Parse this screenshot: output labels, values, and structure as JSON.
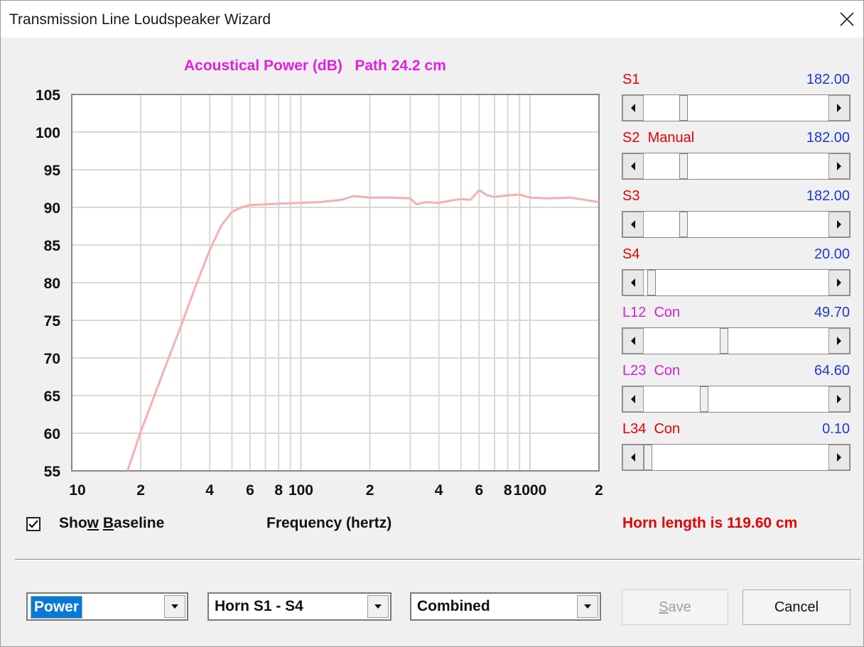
{
  "window": {
    "title": "Transmission Line Loudspeaker Wizard",
    "close_icon": "close-icon"
  },
  "chart_data": {
    "type": "line",
    "title": "Acoustical Power (dB)   Path 24.2 cm",
    "xlabel": "Frequency (hertz)",
    "x_scale": "log",
    "xlim": [
      10,
      2000
    ],
    "ylim": [
      55,
      105
    ],
    "y_ticks": [
      "105",
      "100",
      "95",
      "90",
      "85",
      "80",
      "75",
      "70",
      "65",
      "60",
      "55"
    ],
    "x_tick_labels": [
      {
        "freq": 10,
        "label": "10"
      },
      {
        "freq": 20,
        "label": "2"
      },
      {
        "freq": 40,
        "label": "4"
      },
      {
        "freq": 60,
        "label": "6"
      },
      {
        "freq": 80,
        "label": "8"
      },
      {
        "freq": 100,
        "label": "100"
      },
      {
        "freq": 200,
        "label": "2"
      },
      {
        "freq": 400,
        "label": "4"
      },
      {
        "freq": 600,
        "label": "6"
      },
      {
        "freq": 800,
        "label": "8"
      },
      {
        "freq": 1000,
        "label": "1000"
      },
      {
        "freq": 2000,
        "label": "2"
      }
    ],
    "grid": true,
    "line_color": "#f4b0b0",
    "series": [
      {
        "x": [
          17.5,
          20,
          25,
          30,
          35,
          40,
          45,
          50,
          55,
          60,
          70,
          80,
          100,
          120,
          150,
          170,
          200,
          250,
          300,
          320,
          350,
          400,
          450,
          500,
          550,
          600,
          650,
          700,
          800,
          900,
          1000,
          1200,
          1500,
          2000
        ],
        "y": [
          55,
          60.2,
          68,
          74.3,
          79.8,
          84.3,
          87.6,
          89.4,
          90.0,
          90.3,
          90.4,
          90.5,
          90.6,
          90.7,
          91.0,
          91.5,
          91.3,
          91.3,
          91.2,
          90.4,
          90.7,
          90.6,
          90.9,
          91.1,
          91.0,
          92.3,
          91.6,
          91.4,
          91.6,
          91.7,
          91.3,
          91.2,
          91.3,
          90.7
        ]
      }
    ]
  },
  "sliders": [
    {
      "label": "S1",
      "value": "182.00",
      "color": "#e00000",
      "fraction": 0.2
    },
    {
      "label": "S2  Manual",
      "value": "182.00",
      "color": "#e00000",
      "fraction": 0.2
    },
    {
      "label": "S3",
      "value": "182.00",
      "color": "#e00000",
      "fraction": 0.2
    },
    {
      "label": "S4",
      "value": "20.00",
      "color": "#e00000",
      "fraction": 0.02
    },
    {
      "label": "L12  Con",
      "value": "49.70",
      "color": "#d020d0",
      "fraction": 0.433
    },
    {
      "label": "L23  Con",
      "value": "64.60",
      "color": "#d020d0",
      "fraction": 0.317
    },
    {
      "label": "L34  Con",
      "value": "0.10",
      "color": "#e00000",
      "fraction": 0.0
    }
  ],
  "show_baseline": {
    "label_pre": "Sho",
    "label_u": "w",
    "label_post": " ",
    "label_u2": "B",
    "label_end": "aseline",
    "checked": true
  },
  "horn_length": "Horn length is 119.60 cm",
  "dropdowns": [
    {
      "value": "Power",
      "selected": true
    },
    {
      "value": "Horn S1 - S4",
      "selected": false
    },
    {
      "value": "Combined",
      "selected": false
    }
  ],
  "buttons": {
    "save": "Save",
    "cancel": "Cancel",
    "save_enabled": false
  }
}
